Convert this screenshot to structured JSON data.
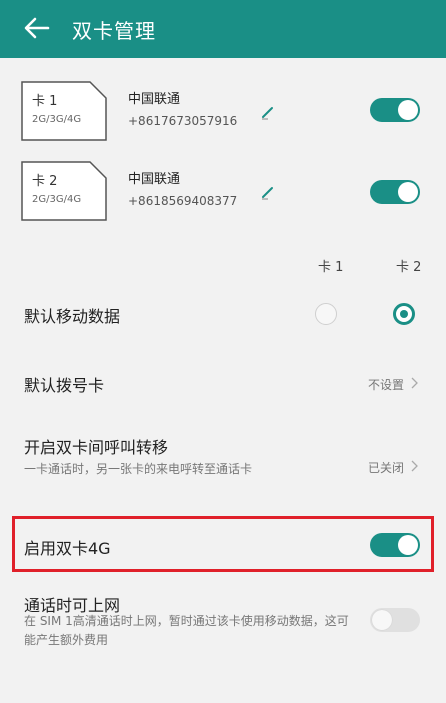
{
  "header": {
    "title": "双卡管理",
    "back_icon": "arrow-left-icon"
  },
  "sims": [
    {
      "name": "卡 1",
      "network": "2G/3G/4G",
      "carrier": "中国联通",
      "phone": "+8617673057916",
      "enabled": true
    },
    {
      "name": "卡 2",
      "network": "2G/3G/4G",
      "carrier": "中国联通",
      "phone": "+8618569408377",
      "enabled": true
    }
  ],
  "columns": {
    "sim1": "卡 1",
    "sim2": "卡 2"
  },
  "default_data": {
    "label": "默认移动数据",
    "selected": "卡 2"
  },
  "default_dial": {
    "label": "默认拨号卡",
    "value": "不设置"
  },
  "call_forward": {
    "label": "开启双卡间呼叫转移",
    "desc": "一卡通话时，另一张卡的来电呼转至通话卡",
    "value": "已关闭"
  },
  "dual_4g": {
    "label": "启用双卡4G",
    "enabled": true
  },
  "internet_during_call": {
    "label": "通话时可上网",
    "desc": "在 SIM 1高清通话时上网，暂时通过该卡使用移动数据，这可能产生额外费用",
    "enabled": false
  },
  "colors": {
    "accent": "#1a8f86",
    "highlight": "#e0202a"
  }
}
